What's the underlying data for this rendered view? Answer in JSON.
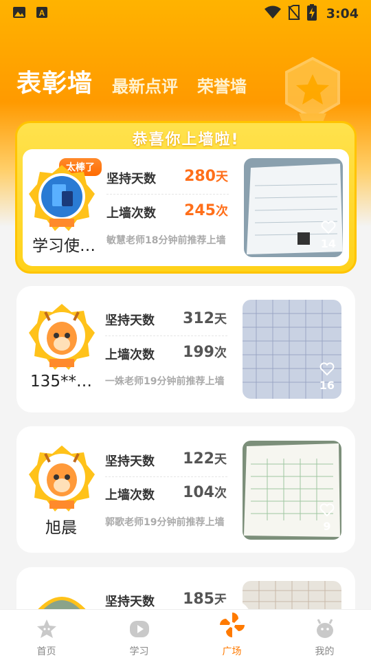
{
  "status_bar": {
    "time": "3:04",
    "left_icons": [
      "image-icon",
      "a-letter-icon"
    ],
    "right_icons": [
      "wifi-icon",
      "no-sim-icon",
      "battery-charging-icon"
    ]
  },
  "header": {
    "tabs": [
      {
        "label": "表彰墙",
        "active": true
      },
      {
        "label": "最新点评",
        "active": false
      },
      {
        "label": "荣誉墙",
        "active": false
      }
    ]
  },
  "featured": {
    "banner": "恭喜你上墙啦!",
    "badge": "太棒了",
    "username": "学习使…",
    "stats": [
      {
        "label": "坚持天数",
        "value": "280",
        "unit": "天"
      },
      {
        "label": "上墙次数",
        "value": "245",
        "unit": "次"
      }
    ],
    "recommend": "敏慧老师18分钟前推荐上墙",
    "likes": "14"
  },
  "cards": [
    {
      "username": "135**…",
      "stats": [
        {
          "label": "坚持天数",
          "value": "312",
          "unit": "天"
        },
        {
          "label": "上墙次数",
          "value": "199",
          "unit": "次"
        }
      ],
      "recommend": "一姝老师19分钟前推荐上墙",
      "likes": "16"
    },
    {
      "username": "旭晨",
      "stats": [
        {
          "label": "坚持天数",
          "value": "122",
          "unit": "天"
        },
        {
          "label": "上墙次数",
          "value": "104",
          "unit": "次"
        }
      ],
      "recommend": "郭歌老师19分钟前推荐上墙",
      "likes": "9"
    },
    {
      "username": "",
      "stats": [
        {
          "label": "坚持天数",
          "value": "185",
          "unit": "天"
        }
      ],
      "recommend": "",
      "likes": ""
    }
  ],
  "bottom_nav": [
    {
      "label": "首页",
      "icon": "star-home-icon",
      "active": false
    },
    {
      "label": "学习",
      "icon": "play-study-icon",
      "active": false
    },
    {
      "label": "广场",
      "icon": "pinwheel-icon",
      "active": true
    },
    {
      "label": "我的",
      "icon": "deer-face-icon",
      "active": false
    }
  ],
  "colors": {
    "accent": "#ff7a00",
    "stat_highlight": "#ff6f1a",
    "hero_top": "#ffb300",
    "featured_border": "#ffc400"
  }
}
